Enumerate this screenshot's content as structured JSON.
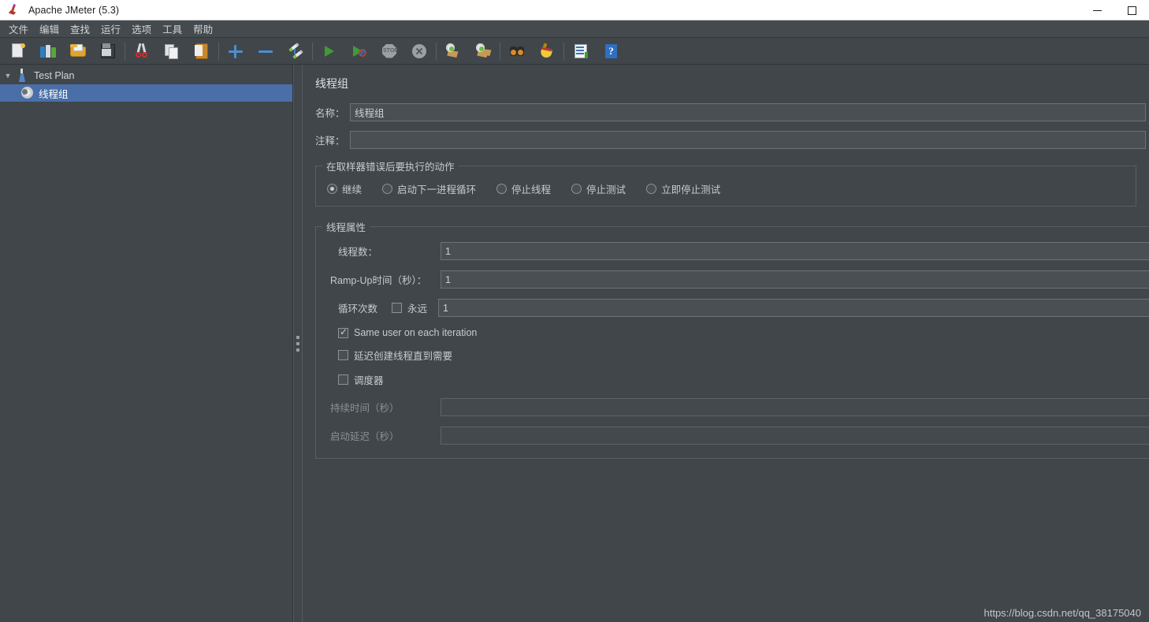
{
  "window": {
    "title": "Apache JMeter (5.3)",
    "app_icon": "jmeter-feather-icon",
    "controls": {
      "minimize": "minimize-icon",
      "maximize": "maximize-icon"
    }
  },
  "menubar": {
    "items": [
      {
        "label": "文件",
        "name": "menu-file"
      },
      {
        "label": "编辑",
        "name": "menu-edit"
      },
      {
        "label": "查找",
        "name": "menu-search"
      },
      {
        "label": "运行",
        "name": "menu-run"
      },
      {
        "label": "选项",
        "name": "menu-options"
      },
      {
        "label": "工具",
        "name": "menu-tools"
      },
      {
        "label": "帮助",
        "name": "menu-help"
      }
    ]
  },
  "toolbar": {
    "icons": [
      "new-test-plan-icon",
      "templates-icon",
      "open-icon",
      "save-icon",
      "cut-icon",
      "copy-icon",
      "paste-icon",
      "expand-all-icon",
      "collapse-all-icon",
      "toggle-icon",
      "start-icon",
      "start-no-pauses-icon",
      "stop-icon",
      "shutdown-icon",
      "clear-icon",
      "clear-all-icon",
      "search-icon",
      "search-reset-icon",
      "function-helper-icon",
      "help-icon"
    ]
  },
  "tree": {
    "items": [
      {
        "label": "Test Plan",
        "icon": "test-plan-icon",
        "selected": false,
        "expanded": true,
        "depth": 0
      },
      {
        "label": "线程组",
        "icon": "thread-group-icon",
        "selected": true,
        "expanded": false,
        "depth": 1
      }
    ]
  },
  "content": {
    "panel_title": "线程组",
    "name_label": "名称：",
    "name_value": "线程组",
    "comment_label": "注释：",
    "comment_value": "",
    "error_action": {
      "legend": "在取样器错误后要执行的动作",
      "options": [
        {
          "label": "继续",
          "selected": true
        },
        {
          "label": "启动下一进程循环",
          "selected": false
        },
        {
          "label": "停止线程",
          "selected": false
        },
        {
          "label": "停止测试",
          "selected": false
        },
        {
          "label": "立即停止测试",
          "selected": false
        }
      ]
    },
    "thread_properties": {
      "legend": "线程属性",
      "threads_label": "线程数：",
      "threads_value": "1",
      "rampup_label": "Ramp-Up时间（秒）：",
      "rampup_value": "1",
      "loop_label": "循环次数",
      "forever_label": "永远",
      "forever_checked": false,
      "loop_value": "1",
      "same_user_label": "Same user on each iteration",
      "same_user_checked": true,
      "delay_create_label": "延迟创建线程直到需要",
      "delay_create_checked": false,
      "scheduler_label": "调度器",
      "scheduler_checked": false,
      "duration_label": "持续时间（秒）",
      "duration_value": "",
      "duration_disabled": true,
      "startup_delay_label": "启动延迟（秒）",
      "startup_delay_value": "",
      "startup_delay_disabled": true
    }
  },
  "watermark": "https://blog.csdn.net/qq_38175040",
  "colors": {
    "background": "#41464a",
    "selection": "#4a6fa8",
    "field_bg": "#4a4f53",
    "text": "#c8cbce",
    "titlebar_bg": "#ffffff"
  }
}
